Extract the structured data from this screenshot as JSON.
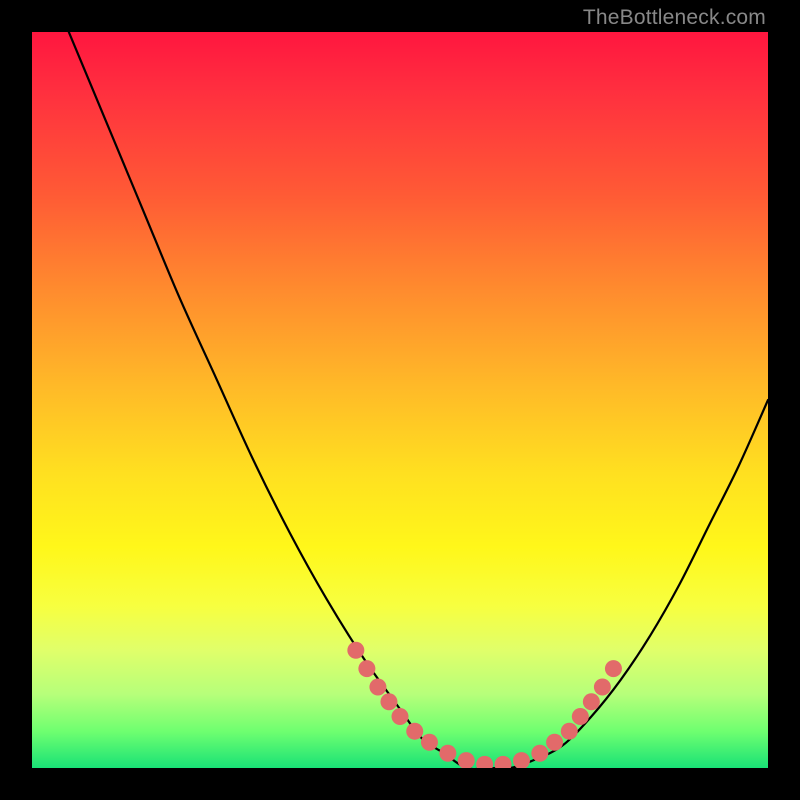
{
  "attribution": "TheBottleneck.com",
  "colors": {
    "background": "#000000",
    "gradient_top": "#ff163f",
    "gradient_bottom": "#19e276",
    "curve": "#000000",
    "dot": "#e26a6a"
  },
  "chart_data": {
    "type": "line",
    "title": "",
    "xlabel": "",
    "ylabel": "",
    "xlim": [
      0,
      100
    ],
    "ylim": [
      0,
      100
    ],
    "grid": false,
    "series": [
      {
        "name": "bottleneck-curve",
        "x": [
          5,
          10,
          15,
          20,
          25,
          30,
          35,
          40,
          45,
          50,
          53,
          56,
          59,
          62,
          65,
          68,
          72,
          76,
          80,
          84,
          88,
          92,
          96,
          100
        ],
        "y": [
          100,
          88,
          76,
          64,
          53,
          42,
          32,
          23,
          15,
          8,
          4,
          2,
          0,
          0,
          0,
          1,
          3,
          7,
          12,
          18,
          25,
          33,
          41,
          50
        ]
      }
    ],
    "dots": {
      "name": "highlight-dots",
      "x": [
        44,
        45.5,
        47,
        48.5,
        50,
        52,
        54,
        56.5,
        59,
        61.5,
        64,
        66.5,
        69,
        71,
        73,
        74.5,
        76,
        77.5,
        79
      ],
      "y": [
        16,
        13.5,
        11,
        9,
        7,
        5,
        3.5,
        2,
        1,
        0.5,
        0.5,
        1,
        2,
        3.5,
        5,
        7,
        9,
        11,
        13.5
      ]
    }
  }
}
